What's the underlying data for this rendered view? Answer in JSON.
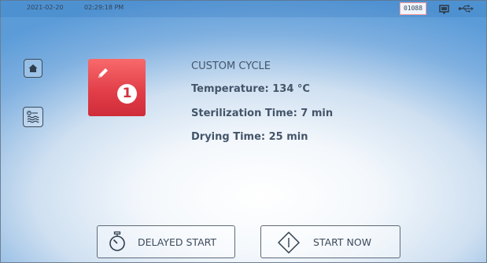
{
  "status_bar": {
    "date": "2021-02-20",
    "time": "02:29:18 PM",
    "counter": "01088",
    "icons": [
      "monitor-icon",
      "usb-icon"
    ]
  },
  "side_nav": {
    "items": [
      {
        "name": "home",
        "icon": "home-icon"
      },
      {
        "name": "program",
        "icon": "program-waves-icon"
      }
    ]
  },
  "cycle": {
    "number": "1",
    "tile_color": "#e23f49",
    "icon": "pencil-icon",
    "name": "CUSTOM CYCLE",
    "temperature": "Temperature: 134 °C",
    "sterilization_time": "Sterilization Time: 7 min",
    "drying_time": "Drying Time: 25 min"
  },
  "actions": {
    "delayed_start_label": "DELAYED START",
    "start_now_label": "START NOW"
  }
}
